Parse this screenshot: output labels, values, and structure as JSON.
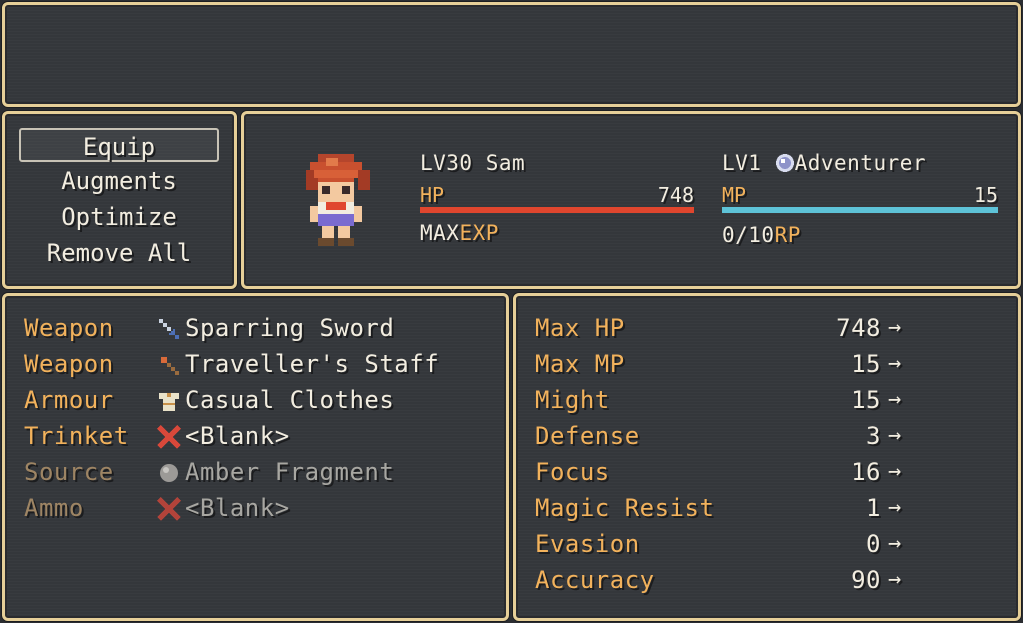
{
  "help": {
    "text": ""
  },
  "commands": [
    {
      "label": "Equip",
      "selected": true
    },
    {
      "label": "Augments",
      "selected": false
    },
    {
      "label": "Optimize",
      "selected": false
    },
    {
      "label": "Remove All",
      "selected": false
    }
  ],
  "actor": {
    "level_name": "LV30 Sam",
    "hp_label": "HP",
    "hp_value": "748",
    "hp_fraction": 1.0,
    "exp_max": "MAX",
    "exp_label": "EXP",
    "class_level": "LV1",
    "class_icon": "adventurer-gem-icon",
    "class_name": "Adventurer",
    "mp_label": "MP",
    "mp_value": "15",
    "mp_fraction": 1.0,
    "jp_value": "0/10",
    "jp_label": "RP"
  },
  "slots": [
    {
      "type": "Weapon",
      "icon": "sword-icon",
      "item": "Sparring Sword",
      "enabled": true
    },
    {
      "type": "Weapon",
      "icon": "staff-icon",
      "item": "Traveller's Staff",
      "enabled": true
    },
    {
      "type": "Armour",
      "icon": "clothes-icon",
      "item": "Casual Clothes",
      "enabled": true
    },
    {
      "type": "Trinket",
      "icon": "blank-x-icon",
      "item": "<Blank>",
      "enabled": true
    },
    {
      "type": "Source",
      "icon": "orb-icon",
      "item": "Amber Fragment",
      "enabled": false
    },
    {
      "type": "Ammo",
      "icon": "blank-x-icon",
      "item": "<Blank>",
      "enabled": false
    }
  ],
  "params": [
    {
      "name": "Max HP",
      "value": "748"
    },
    {
      "name": "Max MP",
      "value": "15"
    },
    {
      "name": "Might",
      "value": "15"
    },
    {
      "name": "Defense",
      "value": "3"
    },
    {
      "name": "Focus",
      "value": "16"
    },
    {
      "name": "Magic Resist",
      "value": "1"
    },
    {
      "name": "Evasion",
      "value": "0"
    },
    {
      "name": "Accuracy",
      "value": "90"
    }
  ],
  "arrow_glyph": "→",
  "colors": {
    "window_bg": "#34373b",
    "border": "#e6cf98",
    "system_text": "#f2b25c",
    "hp_gauge": "#e0462e",
    "mp_gauge": "#5ec3d8"
  }
}
